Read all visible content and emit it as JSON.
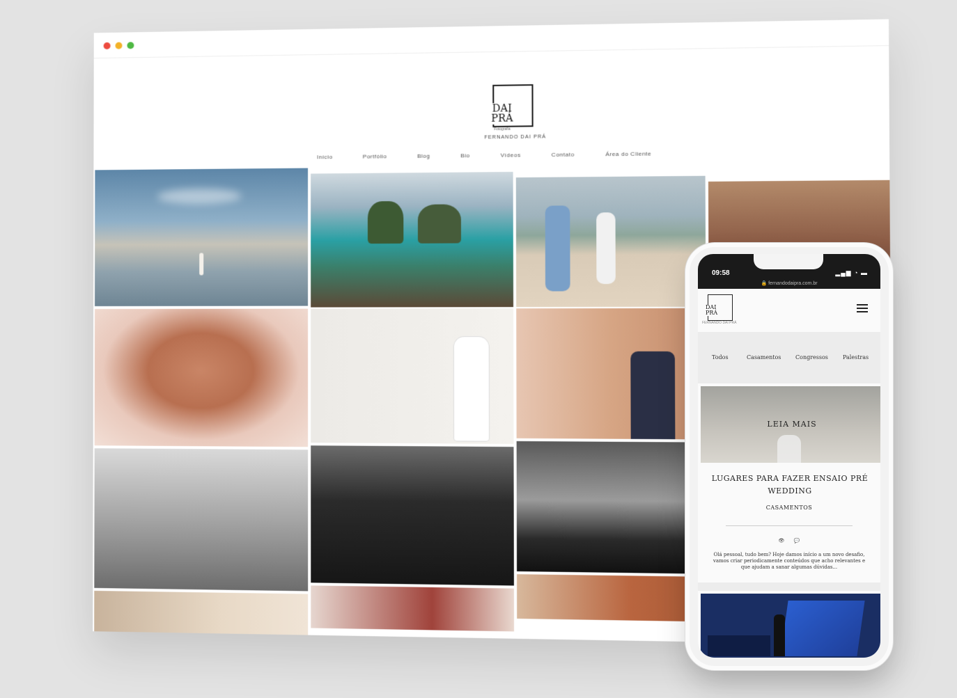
{
  "site": {
    "logo_text": "DAI\nPRÁ",
    "logo_sub": "Fotografia",
    "brand_name": "FERNANDO DAI PRÁ",
    "nav": [
      "Início",
      "Portfólio",
      "Blog",
      "Bio",
      "Vídeos",
      "Contato",
      "Área do Cliente"
    ]
  },
  "phone": {
    "time": "09:58",
    "url": "fernandodaipra.com.br",
    "filters": [
      "Todos",
      "Casamentos",
      "Congressos",
      "Palestras"
    ],
    "hero_label": "LEIA MAIS",
    "post_title": "LUGARES PARA FAZER ENSAIO PRÉ WEDDING",
    "post_category": "CASAMENTOS",
    "post_excerpt": "Olá pessoal, tudo bem? Hoje damos início a um novo desafio, vamos criar periodicamente conteúdos que acho relevantes e que ajudam a sanar algumas dúvidas..."
  },
  "colors": {
    "page_bg": "#e3e3e3",
    "accent_red": "#ed4b3f",
    "accent_yellow": "#f3b229",
    "accent_green": "#4fb944"
  }
}
